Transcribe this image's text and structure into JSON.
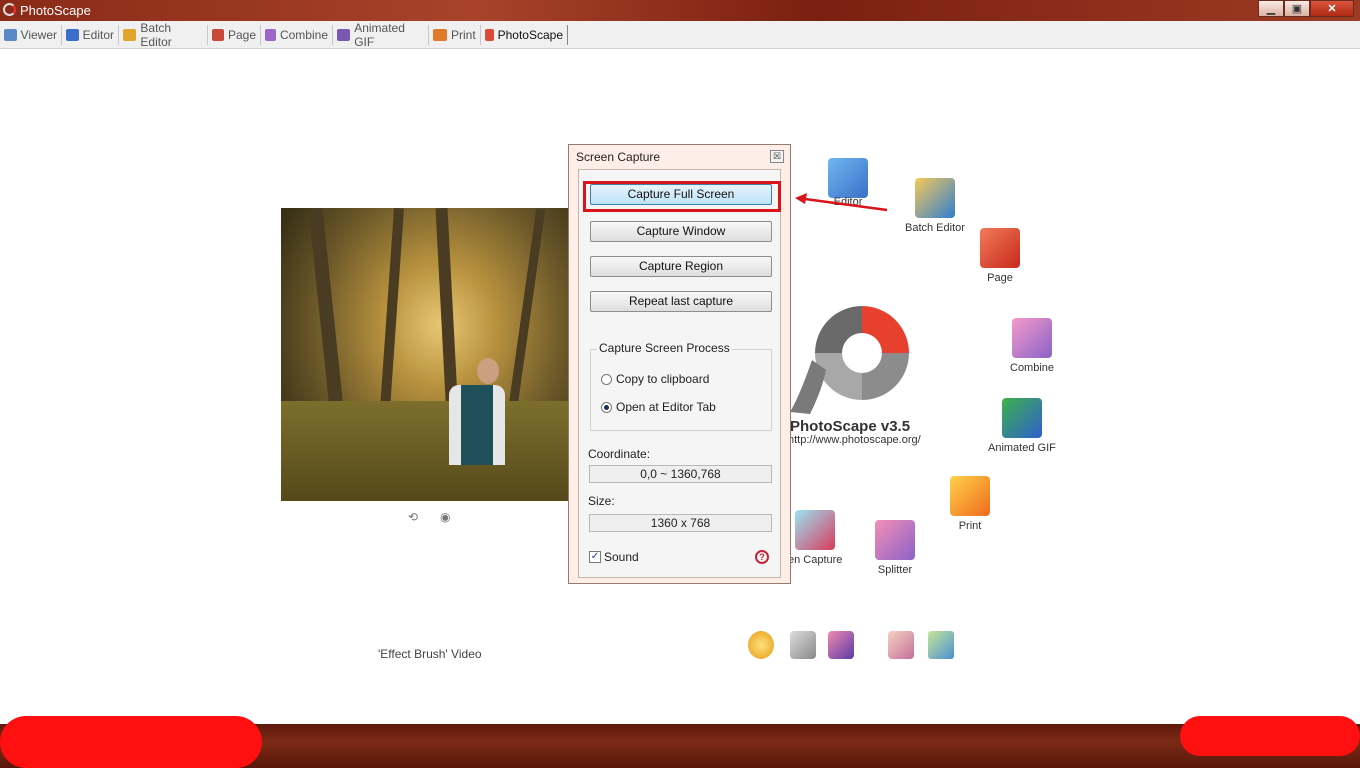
{
  "window": {
    "title": "PhotoScape",
    "controls": {
      "minimize": "▁",
      "maximize": "▣",
      "close": "✕"
    }
  },
  "tabs": [
    {
      "label": "Viewer",
      "color": "#5a8ac6"
    },
    {
      "label": "Editor",
      "color": "#3b6ec9"
    },
    {
      "label": "Batch Editor",
      "color": "#e0a52a"
    },
    {
      "label": "Page",
      "color": "#c94a3b"
    },
    {
      "label": "Combine",
      "color": "#9a66c8"
    },
    {
      "label": "Animated GIF",
      "color": "#7a5ab0"
    },
    {
      "label": "Print",
      "color": "#e07a2a"
    },
    {
      "label": "PhotoScape",
      "color": "#d94a3b",
      "active": true
    }
  ],
  "main": {
    "video_label": "'Effect Brush' Video",
    "logo": {
      "title": "PhotoScape v3.5",
      "url": "http://www.photoscape.org/"
    },
    "app_icons": [
      {
        "label": "Editor",
        "color": "#3b8ed6"
      },
      {
        "label": "Batch Editor",
        "color": "#e5a52a"
      },
      {
        "label": "Page",
        "color": "#d83b2b"
      },
      {
        "label": "Combine",
        "color": "#d0509a"
      },
      {
        "label": "Animated GIF",
        "color": "#2e7fcf"
      },
      {
        "label": "Print",
        "color": "#ef8a1c"
      },
      {
        "label": "en Capture",
        "color": "#c83a5a"
      },
      {
        "label": "Splitter",
        "color": "#8a62c8"
      }
    ]
  },
  "dialog": {
    "title": "Screen Capture",
    "buttons": {
      "capture_full": "Capture Full Screen",
      "capture_window": "Capture Window",
      "capture_region": "Capture Region",
      "repeat_last": "Repeat last capture"
    },
    "process_group": {
      "title": "Capture Screen Process",
      "options": [
        {
          "label": "Copy to clipboard",
          "selected": false
        },
        {
          "label": "Open at Editor Tab",
          "selected": true
        }
      ]
    },
    "coordinate_label": "Coordinate:",
    "coordinate_value": "0,0 ~ 1360,768",
    "size_label": "Size:",
    "size_value": "1360 x 768",
    "sound_label": "Sound",
    "sound_checked": true,
    "close_glyph": "☒",
    "check_glyph": "✓",
    "help_glyph": "?"
  },
  "icons": {
    "refresh": "⟲",
    "eye": "◉"
  }
}
